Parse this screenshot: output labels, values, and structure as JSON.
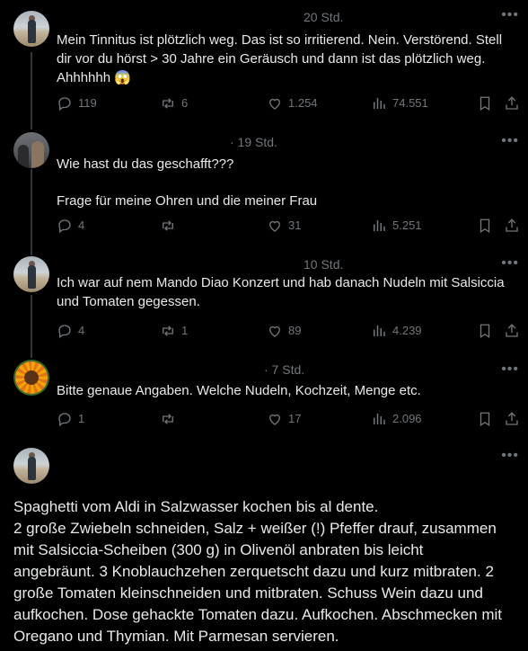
{
  "tweets": [
    {
      "time": "20 Std.",
      "text": "Mein Tinnitus ist plötzlich weg. Das ist so irritierend. Nein. Verstörend. Stell dir vor du hörst > 30 Jahre ein Geräusch und dann ist das plötzlich weg. Ahhhhhh 😱",
      "replies": "119",
      "reposts": "6",
      "likes": "1.254",
      "views": "74.551",
      "avatar": "beach"
    },
    {
      "time": "· 19 Std.",
      "text_lines": [
        "Wie hast du das geschafft???",
        "Frage für meine Ohren und die meiner Frau"
      ],
      "replies": "4",
      "reposts": "",
      "likes": "31",
      "views": "5.251",
      "avatar": "group"
    },
    {
      "time": "10 Std.",
      "text": "Ich war auf nem Mando Diao Konzert und hab danach Nudeln mit Salsiccia und Tomaten gegessen.",
      "replies": "4",
      "reposts": "1",
      "likes": "89",
      "views": "4.239",
      "avatar": "beach"
    },
    {
      "time": "· 7 Std.",
      "text": "Bitte genaue Angaben. Welche Nudeln, Kochzeit, Menge etc.",
      "replies": "1",
      "reposts": "",
      "likes": "17",
      "views": "2.096",
      "avatar": "sunflower"
    }
  ],
  "final_post": {
    "avatar": "beach",
    "lines": [
      "Spaghetti vom Aldi in Salzwasser kochen bis al dente.",
      "2 große Zwiebeln schneiden, Salz + weißer (!) Pfeffer drauf, zusammen",
      "mit Salsiccia-Scheiben (300 g) in Olivenöl anbraten bis leicht",
      "angebräunt. 3 Knoblauchzehen zerquetscht dazu und kurz mitbraten. 2",
      "große Tomaten kleinschneiden und mitbraten. Schuss Wein dazu und",
      "aufkochen. Dose gehackte Tomaten dazu. Aufkochen. Abschmecken mit",
      "Oregano und Thymian. Mit Parmesan servieren."
    ]
  },
  "icons": {
    "more": "more-icon",
    "reply": "reply-icon",
    "repost": "repost-icon",
    "like": "like-icon",
    "views": "views-icon",
    "bookmark": "bookmark-icon",
    "share": "share-icon"
  },
  "colors": {
    "background": "#000000",
    "text": "#e7e9ea",
    "muted": "#71767b",
    "thread_line": "#333639"
  }
}
